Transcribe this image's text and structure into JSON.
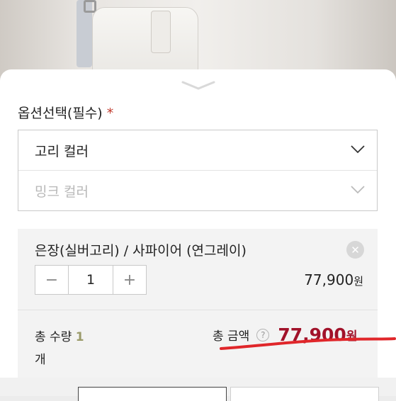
{
  "sheet": {
    "section_label": "옵션선택(필수)",
    "required_mark": "*"
  },
  "select": {
    "selected": "고리 컬러",
    "second": "밍크 컬러"
  },
  "option": {
    "name": "은장(실버고리) / 사파이어 (연그레이)",
    "quantity": "1",
    "price": "77,900",
    "price_unit": "원",
    "minus": "−",
    "plus": "+",
    "remove": "✕"
  },
  "totals": {
    "quantity_label": "총 수량",
    "quantity_value": "1",
    "quantity_unit": "개",
    "amount_label": "총 금액",
    "help": "?",
    "amount_value": "77,900",
    "amount_unit": "원"
  },
  "colors": {
    "accent": "#a1122a",
    "required": "#c0392b",
    "annotation": "#e0262a"
  }
}
